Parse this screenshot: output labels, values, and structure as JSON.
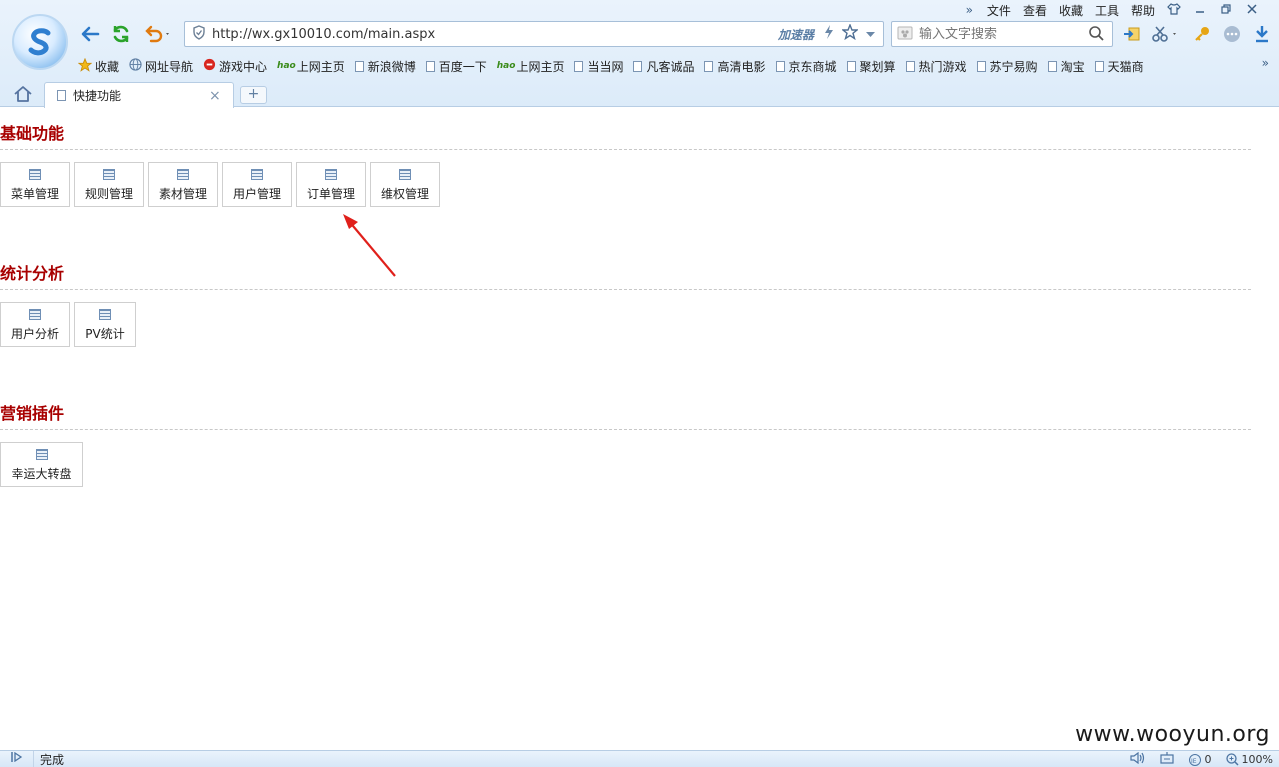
{
  "menubar": {
    "items": [
      "文件",
      "查看",
      "收藏",
      "工具",
      "帮助"
    ],
    "more": "»"
  },
  "address": {
    "url": "http://wx.gx10010.com/main.aspx",
    "accelerator": "加速器"
  },
  "search": {
    "placeholder": "输入文字搜索"
  },
  "bookmarks": [
    {
      "label": "收藏",
      "icon": "star-icon"
    },
    {
      "label": "网址导航",
      "icon": "globe-icon"
    },
    {
      "label": "游戏中心",
      "icon": "game-icon"
    },
    {
      "label": "上网主页",
      "icon": "hao-icon"
    },
    {
      "label": "新浪微博",
      "icon": "page-icon"
    },
    {
      "label": "百度一下",
      "icon": "page-icon"
    },
    {
      "label": "上网主页",
      "icon": "hao-icon"
    },
    {
      "label": "当当网",
      "icon": "page-icon"
    },
    {
      "label": "凡客诚品",
      "icon": "page-icon"
    },
    {
      "label": "高清电影",
      "icon": "page-icon"
    },
    {
      "label": "京东商城",
      "icon": "page-icon"
    },
    {
      "label": "聚划算",
      "icon": "page-icon"
    },
    {
      "label": "热门游戏",
      "icon": "page-icon"
    },
    {
      "label": "苏宁易购",
      "icon": "page-icon"
    },
    {
      "label": "淘宝",
      "icon": "page-icon"
    },
    {
      "label": "天猫商",
      "icon": "page-icon"
    }
  ],
  "tab": {
    "label": "快捷功能",
    "close": "×",
    "new": "+"
  },
  "sections": [
    {
      "title": "基础功能",
      "buttons": [
        "菜单管理",
        "规则管理",
        "素材管理",
        "用户管理",
        "订单管理",
        "维权管理"
      ]
    },
    {
      "title": "统计分析",
      "buttons": [
        "用户分析",
        "PV统计"
      ]
    },
    {
      "title": "营销插件",
      "buttons": [
        "幸运大转盘"
      ]
    }
  ],
  "status": {
    "text": "完成",
    "ie_count": "0",
    "zoom": "100%"
  },
  "watermark": "www.wooyun.org",
  "colors": {
    "section_title": "#a80000",
    "arrow": "#e0201b"
  }
}
